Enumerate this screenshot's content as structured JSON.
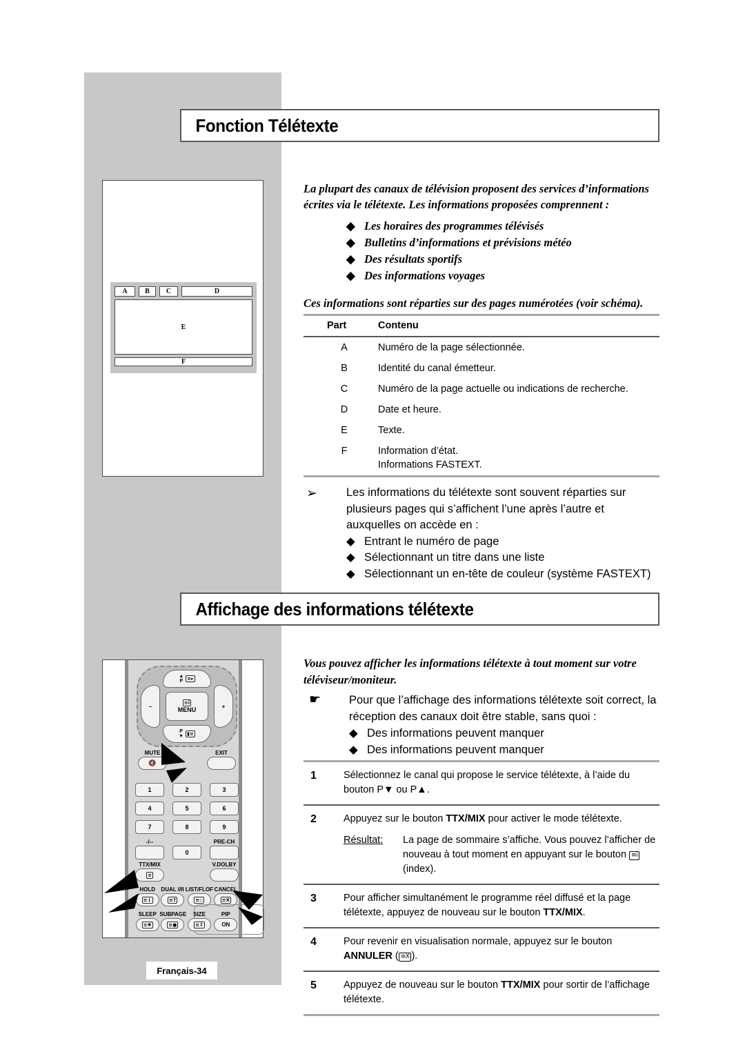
{
  "page": {
    "footer_label": "Français-34"
  },
  "sections": [
    {
      "heading": "Fonction Télétexte"
    },
    {
      "heading": "Affichage des informations télétexte"
    }
  ],
  "intro": {
    "paragraph": "La plupart des canaux de télévision proposent des services d’informations écrites via le télétexte. Les informations proposées comprennent :",
    "bullets": [
      "Les horaires des programmes télévisés",
      "Bulletins d’informations et prévisions météo",
      "Des résultats sportifs",
      "Des informations voyages"
    ],
    "note": "Ces informations sont réparties sur des pages numérotées (voir schéma)."
  },
  "diagram": {
    "top_cells": [
      "A",
      "B",
      "C",
      "D"
    ],
    "body_cell": "E",
    "foot_cell": "F"
  },
  "table": {
    "headers": [
      "Part",
      "Contenu"
    ],
    "rows": [
      {
        "part": "A",
        "contenu": "Numéro de la page sélectionnée."
      },
      {
        "part": "B",
        "contenu": "Identité du canal émetteur."
      },
      {
        "part": "C",
        "contenu": "Numéro de la page actuelle ou indications de recherche."
      },
      {
        "part": "D",
        "contenu": "Date et heure."
      },
      {
        "part": "E",
        "contenu": "Texte."
      },
      {
        "part": "F",
        "contenu": "Information d’état.",
        "contenu2": "Informations FASTEXT."
      }
    ]
  },
  "arrow_note": {
    "icon": "arrow-bullet-icon",
    "text": "Les informations du télétexte sont souvent réparties sur plusieurs pages qui s’affichent l’une après l’autre et auxquelles on accède en :",
    "bullets": [
      "Entrant le numéro de page",
      "Sélectionnant un titre dans une liste",
      "Sélectionnant un en-tête de couleur (système FASTEXT)"
    ]
  },
  "display": {
    "intro": "Vous pouvez afficher les informations télétexte à tout moment sur votre téléviseur/moniteur.",
    "hand_icon": "pointing-hand-icon",
    "hand_text": "Pour que l’affichage des informations télétexte soit correct, la réception des canaux doit être stable, sans quoi :",
    "hand_bullets": [
      "Des informations peuvent manquer",
      "Des informations peuvent manquer"
    ]
  },
  "steps": [
    {
      "num": "1",
      "parts": [
        {
          "t": "Sélectionnez le canal qui propose le service télétexte, à l’aide du bouton P"
        },
        {
          "t": "▼",
          "style": "plain"
        },
        {
          "t": " ou P"
        },
        {
          "t": "▲",
          "style": "plain"
        },
        {
          "t": "."
        }
      ]
    },
    {
      "num": "2",
      "parts": [
        {
          "t": "Appuyez sur le bouton "
        },
        {
          "t": "TTX/MIX",
          "style": "bold"
        },
        {
          "t": " pour activer le mode télétexte."
        }
      ],
      "result_label": "Résultat:",
      "result_parts": [
        {
          "t": "La page de sommaire s’affiche. Vous pouvez l’afficher de nouveau à tout moment en appuyant sur le bouton "
        },
        {
          "t": "≡i",
          "style": "icon"
        },
        {
          "t": " (index)."
        }
      ]
    },
    {
      "num": "3",
      "parts": [
        {
          "t": "Pour afficher simultanément le programme réel diffusé et la page télétexte, appuyez de nouveau sur le bouton "
        },
        {
          "t": "TTX/MIX",
          "style": "bold"
        },
        {
          "t": "."
        }
      ]
    },
    {
      "num": "4",
      "parts": [
        {
          "t": "Pour revenir en visualisation normale, appuyez sur le bouton "
        },
        {
          "t": "ANNULER",
          "style": "bold"
        },
        {
          "t": " ("
        },
        {
          "t": "≡X",
          "style": "icon"
        },
        {
          "t": ")."
        }
      ]
    },
    {
      "num": "5",
      "parts": [
        {
          "t": "Appuyez de nouveau sur le bouton "
        },
        {
          "t": "TTX/MIX",
          "style": "bold"
        },
        {
          "t": " pour sortir de l’affichage télétexte."
        }
      ]
    }
  ],
  "remote": {
    "dpad": {
      "up_label": "▲\nP",
      "up_icon": "≡▸",
      "down_label": "P\n▼",
      "down_icon": "▮≡",
      "left_label": "–",
      "right_label": "+",
      "menu_icon": "≡i",
      "menu_label": "MENU"
    },
    "mute_label": "MUTE",
    "mute_icon": "mute-speaker-icon",
    "exit_label": "EXIT",
    "numpad": [
      "1",
      "2",
      "3",
      "4",
      "5",
      "6",
      "7",
      "8",
      "9"
    ],
    "numpad_extra": {
      "left": "-/--",
      "zero": "0",
      "right": "PRE-CH"
    },
    "fn_row_1": [
      {
        "label": "TTX/MIX",
        "icon": "≡"
      },
      {
        "label": "V.DOLBY",
        "icon": ""
      }
    ],
    "fn_row_2": [
      {
        "label": "HOLD",
        "icon": "≡↓"
      },
      {
        "label": "DUAL I/II",
        "icon": "≡?"
      },
      {
        "label": "LIST/FLOF",
        "icon": "≡▫"
      },
      {
        "label": "CANCEL",
        "icon": "≡X"
      }
    ],
    "fn_row_3": [
      {
        "label": "SLEEP",
        "icon": "≡✺"
      },
      {
        "label": "SUBPAGE",
        "icon": "≡●"
      },
      {
        "label": "SIZE",
        "icon": "≡↕"
      },
      {
        "label": "PIP",
        "icon": "ON"
      }
    ]
  },
  "colors": {
    "band_gray": "#c8c8c8",
    "rule_gray": "#a8a8a8",
    "rule_dark": "#585858",
    "ink": "#000000"
  }
}
